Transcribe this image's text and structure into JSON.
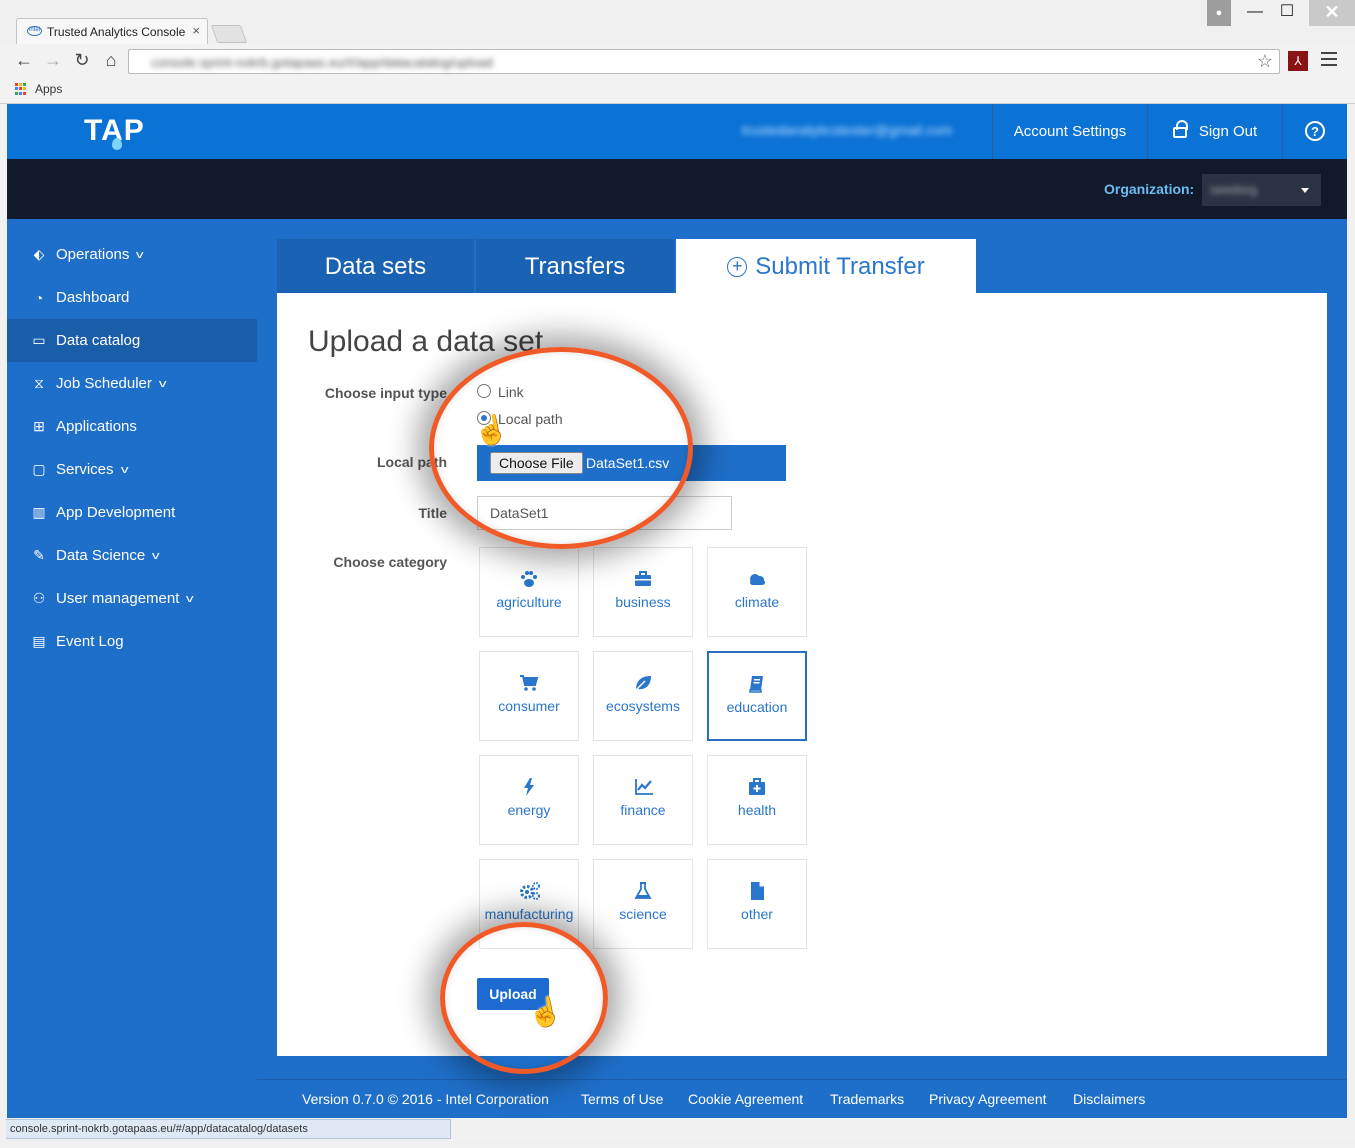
{
  "browser": {
    "tab_title": "Trusted Analytics Console",
    "tab_close": "×",
    "favicon_text": "intel",
    "url": "console.sprint-nokrb.gotapaas.eu/#/app/datacatalog/upload",
    "bookmarks_apps": "Apps",
    "status_url": "console.sprint-nokrb.gotapaas.eu/#/app/datacatalog/datasets",
    "win_min": "—",
    "win_max": "☐",
    "win_close": "✕"
  },
  "topbar": {
    "logo": "TAP",
    "user_email": "trustedanalyticstester@gmail.com",
    "account_settings": "Account Settings",
    "sign_out": "Sign Out",
    "help": "?"
  },
  "org": {
    "label": "Organization:",
    "value": "seedorg"
  },
  "sidebar": {
    "items": [
      {
        "label": "Operations",
        "icon": "tag-icon",
        "chevron": true
      },
      {
        "label": "Dashboard",
        "icon": "gauge-icon",
        "chevron": false
      },
      {
        "label": "Data catalog",
        "icon": "folder-icon",
        "chevron": false
      },
      {
        "label": "Job Scheduler",
        "icon": "hourglass-icon",
        "chevron": true
      },
      {
        "label": "Applications",
        "icon": "grid-icon",
        "chevron": false
      },
      {
        "label": "Services",
        "icon": "clipboard-icon",
        "chevron": true
      },
      {
        "label": "App Development",
        "icon": "building-icon",
        "chevron": false
      },
      {
        "label": "Data Science",
        "icon": "wrench-icon",
        "chevron": true
      },
      {
        "label": "User management",
        "icon": "user-icon",
        "chevron": true
      },
      {
        "label": "Event Log",
        "icon": "book-icon",
        "chevron": false
      }
    ],
    "active": "Data catalog"
  },
  "tabs": {
    "datasets": "Data sets",
    "transfers": "Transfers",
    "submit": "Submit Transfer",
    "submit_plus": "+"
  },
  "form": {
    "title": "Upload a data set",
    "input_type_label": "Choose input type",
    "radio_link": "Link",
    "radio_local": "Local path",
    "selected_input_type": "Local path",
    "local_path_label": "Local path",
    "choose_file": "Choose File",
    "file_name": "DataSet1.csv",
    "title_label": "Title",
    "title_value": "DataSet1",
    "category_label": "Choose category",
    "selected_category": "education",
    "upload": "Upload"
  },
  "categories": [
    {
      "label": "agriculture",
      "icon": "paw-icon"
    },
    {
      "label": "business",
      "icon": "briefcase-icon"
    },
    {
      "label": "climate",
      "icon": "cloud-icon"
    },
    {
      "label": "consumer",
      "icon": "cart-icon"
    },
    {
      "label": "ecosystems",
      "icon": "leaf-icon"
    },
    {
      "label": "education",
      "icon": "book-icon"
    },
    {
      "label": "energy",
      "icon": "bolt-icon"
    },
    {
      "label": "finance",
      "icon": "line-chart-icon"
    },
    {
      "label": "health",
      "icon": "medkit-icon"
    },
    {
      "label": "manufacturing",
      "icon": "cogs-icon"
    },
    {
      "label": "science",
      "icon": "flask-icon"
    },
    {
      "label": "other",
      "icon": "file-icon"
    }
  ],
  "footer": {
    "version": "Version 0.7.0 © 2016 - Intel Corporation",
    "terms": "Terms of Use",
    "cookie": "Cookie Agreement",
    "trademarks": "Trademarks",
    "privacy": "Privacy Agreement",
    "disclaimers": "Disclaimers"
  },
  "colors": {
    "brand_blue": "#1e6fc9",
    "topbar_blue": "#0b72d6",
    "org_bar": "#11192b",
    "highlight_orange": "#f05a28"
  }
}
